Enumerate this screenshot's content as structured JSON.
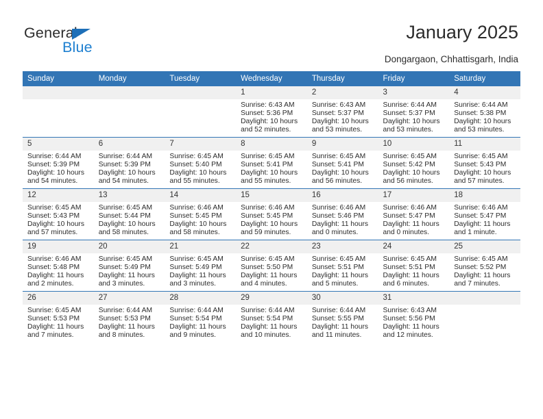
{
  "brand": {
    "name_top": "General",
    "name_bottom": "Blue",
    "accent_color": "#1d7fd0",
    "triangle_color": "#1d6fb8"
  },
  "header": {
    "title": "January 2025",
    "location": "Dongargaon, Chhattisgarh, India"
  },
  "theme": {
    "header_band": "#3275b5",
    "daynum_strip": "#f0f0f0",
    "row_divider": "#3275b5",
    "text": "#2b2b2b"
  },
  "columns": [
    "Sunday",
    "Monday",
    "Tuesday",
    "Wednesday",
    "Thursday",
    "Friday",
    "Saturday"
  ],
  "weeks": [
    [
      {
        "day": "",
        "empty": true
      },
      {
        "day": "",
        "empty": true
      },
      {
        "day": "",
        "empty": true
      },
      {
        "day": "1",
        "sunrise": "Sunrise: 6:43 AM",
        "sunset": "Sunset: 5:36 PM",
        "daylight_1": "Daylight: 10 hours",
        "daylight_2": "and 52 minutes."
      },
      {
        "day": "2",
        "sunrise": "Sunrise: 6:43 AM",
        "sunset": "Sunset: 5:37 PM",
        "daylight_1": "Daylight: 10 hours",
        "daylight_2": "and 53 minutes."
      },
      {
        "day": "3",
        "sunrise": "Sunrise: 6:44 AM",
        "sunset": "Sunset: 5:37 PM",
        "daylight_1": "Daylight: 10 hours",
        "daylight_2": "and 53 minutes."
      },
      {
        "day": "4",
        "sunrise": "Sunrise: 6:44 AM",
        "sunset": "Sunset: 5:38 PM",
        "daylight_1": "Daylight: 10 hours",
        "daylight_2": "and 53 minutes."
      }
    ],
    [
      {
        "day": "5",
        "sunrise": "Sunrise: 6:44 AM",
        "sunset": "Sunset: 5:39 PM",
        "daylight_1": "Daylight: 10 hours",
        "daylight_2": "and 54 minutes."
      },
      {
        "day": "6",
        "sunrise": "Sunrise: 6:44 AM",
        "sunset": "Sunset: 5:39 PM",
        "daylight_1": "Daylight: 10 hours",
        "daylight_2": "and 54 minutes."
      },
      {
        "day": "7",
        "sunrise": "Sunrise: 6:45 AM",
        "sunset": "Sunset: 5:40 PM",
        "daylight_1": "Daylight: 10 hours",
        "daylight_2": "and 55 minutes."
      },
      {
        "day": "8",
        "sunrise": "Sunrise: 6:45 AM",
        "sunset": "Sunset: 5:41 PM",
        "daylight_1": "Daylight: 10 hours",
        "daylight_2": "and 55 minutes."
      },
      {
        "day": "9",
        "sunrise": "Sunrise: 6:45 AM",
        "sunset": "Sunset: 5:41 PM",
        "daylight_1": "Daylight: 10 hours",
        "daylight_2": "and 56 minutes."
      },
      {
        "day": "10",
        "sunrise": "Sunrise: 6:45 AM",
        "sunset": "Sunset: 5:42 PM",
        "daylight_1": "Daylight: 10 hours",
        "daylight_2": "and 56 minutes."
      },
      {
        "day": "11",
        "sunrise": "Sunrise: 6:45 AM",
        "sunset": "Sunset: 5:43 PM",
        "daylight_1": "Daylight: 10 hours",
        "daylight_2": "and 57 minutes."
      }
    ],
    [
      {
        "day": "12",
        "sunrise": "Sunrise: 6:45 AM",
        "sunset": "Sunset: 5:43 PM",
        "daylight_1": "Daylight: 10 hours",
        "daylight_2": "and 57 minutes."
      },
      {
        "day": "13",
        "sunrise": "Sunrise: 6:45 AM",
        "sunset": "Sunset: 5:44 PM",
        "daylight_1": "Daylight: 10 hours",
        "daylight_2": "and 58 minutes."
      },
      {
        "day": "14",
        "sunrise": "Sunrise: 6:46 AM",
        "sunset": "Sunset: 5:45 PM",
        "daylight_1": "Daylight: 10 hours",
        "daylight_2": "and 58 minutes."
      },
      {
        "day": "15",
        "sunrise": "Sunrise: 6:46 AM",
        "sunset": "Sunset: 5:45 PM",
        "daylight_1": "Daylight: 10 hours",
        "daylight_2": "and 59 minutes."
      },
      {
        "day": "16",
        "sunrise": "Sunrise: 6:46 AM",
        "sunset": "Sunset: 5:46 PM",
        "daylight_1": "Daylight: 11 hours",
        "daylight_2": "and 0 minutes."
      },
      {
        "day": "17",
        "sunrise": "Sunrise: 6:46 AM",
        "sunset": "Sunset: 5:47 PM",
        "daylight_1": "Daylight: 11 hours",
        "daylight_2": "and 0 minutes."
      },
      {
        "day": "18",
        "sunrise": "Sunrise: 6:46 AM",
        "sunset": "Sunset: 5:47 PM",
        "daylight_1": "Daylight: 11 hours",
        "daylight_2": "and 1 minute."
      }
    ],
    [
      {
        "day": "19",
        "sunrise": "Sunrise: 6:46 AM",
        "sunset": "Sunset: 5:48 PM",
        "daylight_1": "Daylight: 11 hours",
        "daylight_2": "and 2 minutes."
      },
      {
        "day": "20",
        "sunrise": "Sunrise: 6:45 AM",
        "sunset": "Sunset: 5:49 PM",
        "daylight_1": "Daylight: 11 hours",
        "daylight_2": "and 3 minutes."
      },
      {
        "day": "21",
        "sunrise": "Sunrise: 6:45 AM",
        "sunset": "Sunset: 5:49 PM",
        "daylight_1": "Daylight: 11 hours",
        "daylight_2": "and 3 minutes."
      },
      {
        "day": "22",
        "sunrise": "Sunrise: 6:45 AM",
        "sunset": "Sunset: 5:50 PM",
        "daylight_1": "Daylight: 11 hours",
        "daylight_2": "and 4 minutes."
      },
      {
        "day": "23",
        "sunrise": "Sunrise: 6:45 AM",
        "sunset": "Sunset: 5:51 PM",
        "daylight_1": "Daylight: 11 hours",
        "daylight_2": "and 5 minutes."
      },
      {
        "day": "24",
        "sunrise": "Sunrise: 6:45 AM",
        "sunset": "Sunset: 5:51 PM",
        "daylight_1": "Daylight: 11 hours",
        "daylight_2": "and 6 minutes."
      },
      {
        "day": "25",
        "sunrise": "Sunrise: 6:45 AM",
        "sunset": "Sunset: 5:52 PM",
        "daylight_1": "Daylight: 11 hours",
        "daylight_2": "and 7 minutes."
      }
    ],
    [
      {
        "day": "26",
        "sunrise": "Sunrise: 6:45 AM",
        "sunset": "Sunset: 5:53 PM",
        "daylight_1": "Daylight: 11 hours",
        "daylight_2": "and 7 minutes."
      },
      {
        "day": "27",
        "sunrise": "Sunrise: 6:44 AM",
        "sunset": "Sunset: 5:53 PM",
        "daylight_1": "Daylight: 11 hours",
        "daylight_2": "and 8 minutes."
      },
      {
        "day": "28",
        "sunrise": "Sunrise: 6:44 AM",
        "sunset": "Sunset: 5:54 PM",
        "daylight_1": "Daylight: 11 hours",
        "daylight_2": "and 9 minutes."
      },
      {
        "day": "29",
        "sunrise": "Sunrise: 6:44 AM",
        "sunset": "Sunset: 5:54 PM",
        "daylight_1": "Daylight: 11 hours",
        "daylight_2": "and 10 minutes."
      },
      {
        "day": "30",
        "sunrise": "Sunrise: 6:44 AM",
        "sunset": "Sunset: 5:55 PM",
        "daylight_1": "Daylight: 11 hours",
        "daylight_2": "and 11 minutes."
      },
      {
        "day": "31",
        "sunrise": "Sunrise: 6:43 AM",
        "sunset": "Sunset: 5:56 PM",
        "daylight_1": "Daylight: 11 hours",
        "daylight_2": "and 12 minutes."
      },
      {
        "day": "",
        "empty": true
      }
    ]
  ]
}
